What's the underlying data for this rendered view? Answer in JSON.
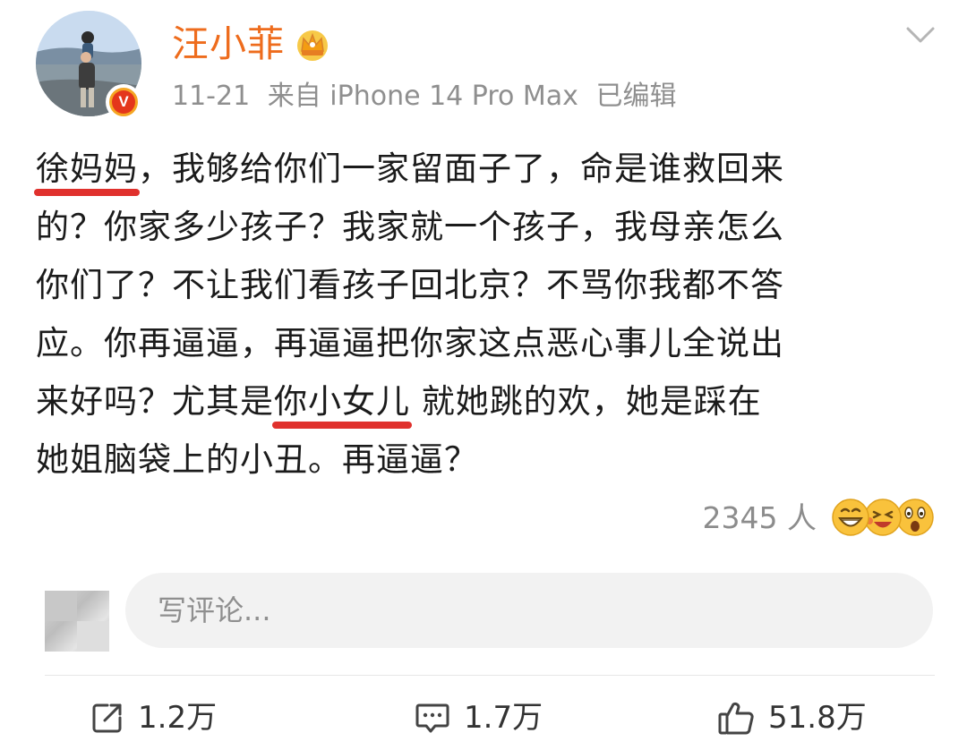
{
  "header": {
    "username": "汪小菲",
    "date": "11-21",
    "source": "来自 iPhone 14 Pro Max",
    "edited": "已编辑",
    "verified_badge": "V"
  },
  "post": {
    "lines": [
      [
        "徐妈妈",
        "，我够给你们一家留面子了，命是谁救回来"
      ],
      [
        "的？你家多少孩子？我家就一个孩子，我母亲怎么"
      ],
      [
        "你们了？不让我们看孩子回北京？不骂你我都不答"
      ],
      [
        "应。你再逼逼，再逼逼把你家这点恶心事儿全说出"
      ],
      [
        "来好吗？尤其是",
        "你小女儿",
        " 就她跳的欢，她是踩在"
      ],
      [
        "她姐脑袋上的小丑。再逼逼？"
      ]
    ]
  },
  "reactions": {
    "count_text": "2345 人",
    "emojis": [
      "grin-icon",
      "laugh-tears-icon",
      "surprised-icon"
    ]
  },
  "comment_box": {
    "placeholder": "写评论..."
  },
  "actions": {
    "repost": {
      "icon": "repost-icon",
      "count": "1.2万"
    },
    "comment": {
      "icon": "comment-icon",
      "count": "1.7万"
    },
    "like": {
      "icon": "thumbs-up-icon",
      "count": "51.8万"
    }
  },
  "colors": {
    "username": "#ee6c1d",
    "underline": "#e0312d",
    "meta": "#8f8f8f",
    "badge_outer": "#f5a623",
    "badge_inner": "#e4361b"
  }
}
